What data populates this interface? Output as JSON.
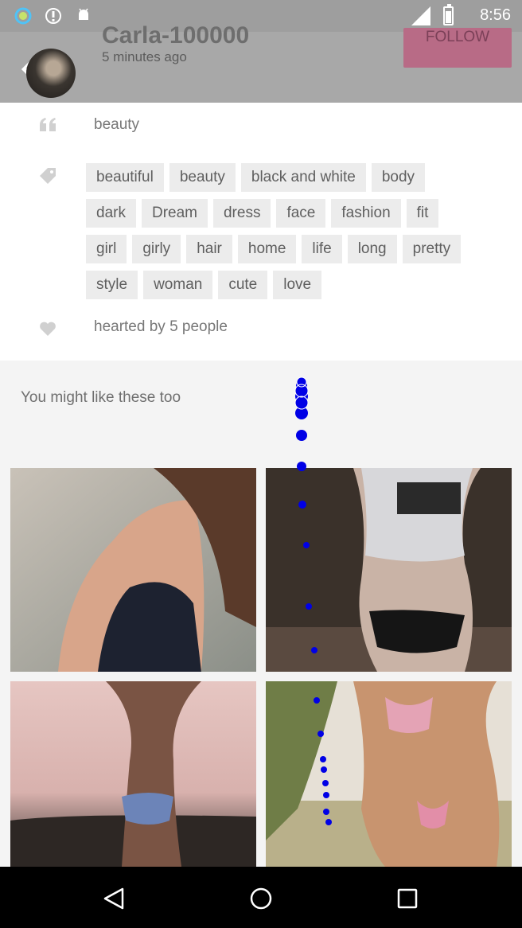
{
  "status_bar": {
    "time": "8:56",
    "icons": [
      "circle-app-icon",
      "alert-icon",
      "android-icon",
      "signal-icon",
      "battery-icon"
    ]
  },
  "header": {
    "username": "Carla-100000",
    "timestamp": "5 minutes ago",
    "follow_label": "FOLLOW"
  },
  "post": {
    "caption": "beauty",
    "tags": [
      "beautiful",
      "beauty",
      "black and white",
      "body",
      "dark",
      "Dream",
      "dress",
      "face",
      "fashion",
      "fit",
      "girl",
      "girly",
      "hair",
      "home",
      "life",
      "long",
      "pretty",
      "style",
      "woman",
      "cute",
      "love"
    ],
    "hearted_text": "hearted by 5 people"
  },
  "suggestions": {
    "title": "You might like these too"
  },
  "colors": {
    "accent_pink": "#b86b86",
    "header_gray": "#a8a8a8",
    "trace_blue": "#0000e6"
  }
}
